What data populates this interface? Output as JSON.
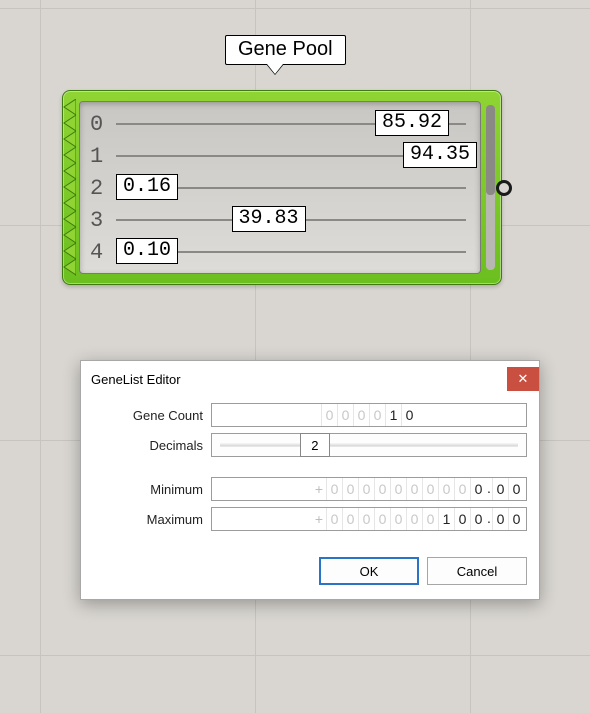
{
  "node_label": "Gene Pool",
  "gene_pool": {
    "rows": [
      {
        "index": "0",
        "value": "85.92",
        "pos": 0.74
      },
      {
        "index": "1",
        "value": "94.35",
        "pos": 0.82
      },
      {
        "index": "2",
        "value": "0.16",
        "pos": 0.01
      },
      {
        "index": "3",
        "value": "39.83",
        "pos": 0.35
      },
      {
        "index": "4",
        "value": "0.10",
        "pos": 0.01
      }
    ]
  },
  "dialog": {
    "title": "GeneList Editor",
    "close": "✕",
    "labels": {
      "gene_count": "Gene Count",
      "decimals": "Decimals",
      "minimum": "Minimum",
      "maximum": "Maximum"
    },
    "gene_count": {
      "faded": [
        "0",
        "0",
        "0",
        "0"
      ],
      "strong": [
        "1",
        "0"
      ]
    },
    "decimals": {
      "value": "2",
      "pos": 0.28
    },
    "minimum": {
      "sign": "+",
      "int_faded": [
        "0",
        "0",
        "0",
        "0",
        "0",
        "0",
        "0",
        "0",
        "0"
      ],
      "int_strong": [
        "0"
      ],
      "dec": [
        "0",
        "0"
      ]
    },
    "maximum": {
      "sign": "+",
      "int_faded": [
        "0",
        "0",
        "0",
        "0",
        "0",
        "0",
        "0"
      ],
      "int_strong": [
        "1",
        "0",
        "0"
      ],
      "dec": [
        "0",
        "0"
      ]
    },
    "ok": "OK",
    "cancel": "Cancel"
  }
}
